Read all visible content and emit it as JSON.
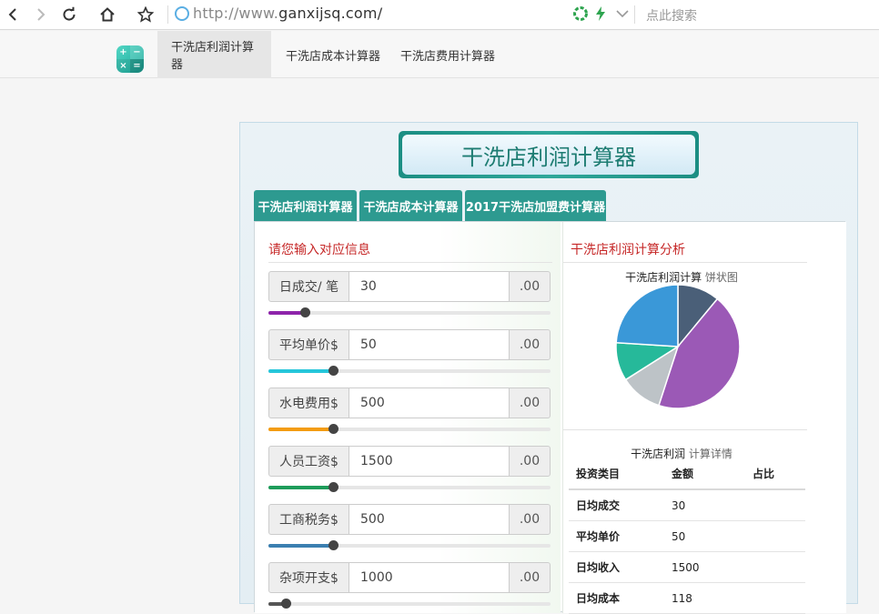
{
  "browser": {
    "url_prefix": "http://www.",
    "url_main": "ganxijsq.com/",
    "search_placeholder": "点此搜索"
  },
  "site_nav": {
    "tabs": [
      {
        "label": "干洗店利润计算器",
        "active": true
      },
      {
        "label": "干洗店成本计算器",
        "active": false
      },
      {
        "label": "干洗店费用计算器",
        "active": false
      }
    ]
  },
  "calculator": {
    "title": "干洗店利润计算器",
    "tabs": [
      {
        "label": "干洗店利润计算器"
      },
      {
        "label": "干洗店成本计算器"
      },
      {
        "label": "2017干洗店加盟费计算器"
      }
    ],
    "input_section_title": "请您输入对应信息",
    "analysis_section_title": "干洗店利润计算分析",
    "fields": [
      {
        "label": "日成交/ 笔",
        "value": "30",
        "suffix": ".00",
        "slider_fraction": 0.13,
        "slider_color": "#8e24aa"
      },
      {
        "label": "平均单价$",
        "value": "50",
        "suffix": ".00",
        "slider_fraction": 0.23,
        "slider_color": "#26c6da"
      },
      {
        "label": "水电费用$",
        "value": "500",
        "suffix": ".00",
        "slider_fraction": 0.23,
        "slider_color": "#f39c12"
      },
      {
        "label": "人员工资$",
        "value": "1500",
        "suffix": ".00",
        "slider_fraction": 0.23,
        "slider_color": "#1e9c5a"
      },
      {
        "label": "工商税务$",
        "value": "500",
        "suffix": ".00",
        "slider_fraction": 0.23,
        "slider_color": "#3b7fb0"
      },
      {
        "label": "杂项开支$",
        "value": "1000",
        "suffix": ".00",
        "slider_fraction": 0.06,
        "slider_color": "#555555"
      }
    ],
    "pie": {
      "title": "干洗店利润计算",
      "title_sub": "饼状图",
      "slices": [
        {
          "value": 0.11,
          "color": "#4a5f78"
        },
        {
          "value": 0.44,
          "color": "#9b59b6"
        },
        {
          "value": 0.11,
          "color": "#bdc3c7"
        },
        {
          "value": 0.1,
          "color": "#26b99a"
        },
        {
          "value": 0.24,
          "color": "#3a98d8"
        }
      ]
    },
    "detail": {
      "title": "干洗店利润",
      "title_sub": "计算详情",
      "headers": [
        "投资类目",
        "金额",
        "占比"
      ],
      "rows": [
        {
          "name": "日均成交",
          "amount": "30",
          "ratio": ""
        },
        {
          "name": "平均单价",
          "amount": "50",
          "ratio": ""
        },
        {
          "name": "日均收入",
          "amount": "1500",
          "ratio": ""
        },
        {
          "name": "日均成本",
          "amount": "118",
          "ratio": ""
        }
      ]
    }
  }
}
